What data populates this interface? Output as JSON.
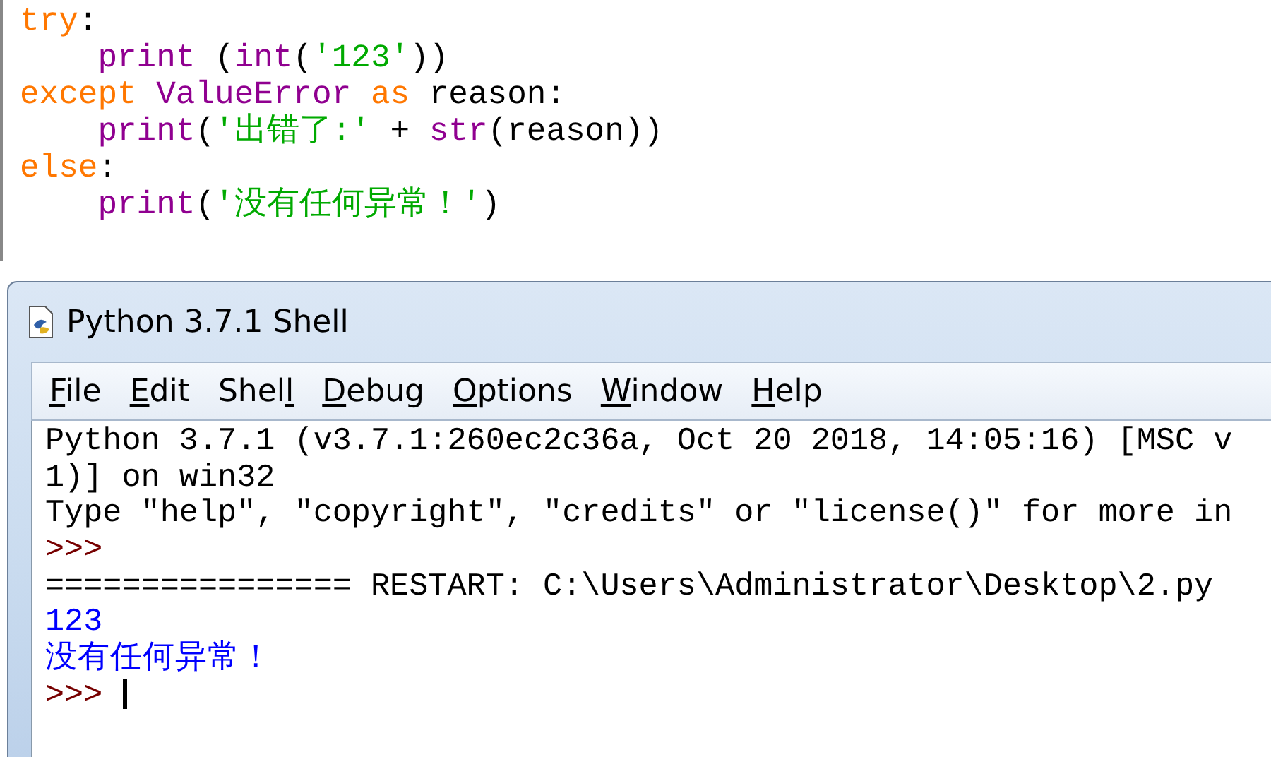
{
  "editor": {
    "lines": [
      {
        "indented": false,
        "tokens": [
          {
            "kind": "keyword",
            "text": "try"
          },
          {
            "kind": "plain",
            "text": ":"
          }
        ]
      },
      {
        "indented": true,
        "tokens": [
          {
            "kind": "builtin",
            "text": "print"
          },
          {
            "kind": "plain",
            "text": "(",
            "space_before": true
          },
          {
            "kind": "builtin",
            "text": "int"
          },
          {
            "kind": "plain",
            "text": "("
          },
          {
            "kind": "string",
            "text": "'123'"
          },
          {
            "kind": "plain",
            "text": "))"
          }
        ]
      },
      {
        "indented": false,
        "tokens": [
          {
            "kind": "keyword",
            "text": "except"
          },
          {
            "kind": "builtin",
            "text": "ValueError",
            "space_before": true
          },
          {
            "kind": "keyword",
            "text": "as",
            "space_before": true
          },
          {
            "kind": "plain",
            "text": "reason:",
            "space_before": true
          }
        ]
      },
      {
        "indented": true,
        "tokens": [
          {
            "kind": "builtin",
            "text": "print"
          },
          {
            "kind": "plain",
            "text": "("
          },
          {
            "kind": "string",
            "text": "'出错了:'"
          },
          {
            "kind": "plain",
            "text": "+",
            "space_before": true
          },
          {
            "kind": "builtin",
            "text": "str",
            "space_before": true
          },
          {
            "kind": "plain",
            "text": "(reason))"
          }
        ]
      },
      {
        "indented": false,
        "tokens": [
          {
            "kind": "keyword",
            "text": "else"
          },
          {
            "kind": "plain",
            "text": ":"
          }
        ]
      },
      {
        "indented": true,
        "tokens": [
          {
            "kind": "builtin",
            "text": "print"
          },
          {
            "kind": "plain",
            "text": "("
          },
          {
            "kind": "string",
            "text": "'没有任何异常！'"
          },
          {
            "kind": "plain",
            "text": ")"
          }
        ]
      }
    ]
  },
  "window": {
    "title": "Python 3.7.1 Shell"
  },
  "menu": [
    {
      "key": "F",
      "rest": "ile"
    },
    {
      "key": "E",
      "rest": "dit"
    },
    {
      "lead": "Shel",
      "key": "l"
    },
    {
      "key": "D",
      "rest": "ebug"
    },
    {
      "key": "O",
      "rest": "ptions"
    },
    {
      "key": "W",
      "rest": "indow"
    },
    {
      "key": "H",
      "rest": "elp"
    }
  ],
  "shell": {
    "lines": [
      {
        "cursor": false,
        "tokens": [
          {
            "kind": "output",
            "text": "Python 3.7.1 (v3.7.1:260ec2c36a, Oct 20 2018, 14:05:16) [MSC v"
          }
        ]
      },
      {
        "cursor": false,
        "tokens": [
          {
            "kind": "output",
            "text": "1)] on win32"
          }
        ]
      },
      {
        "cursor": false,
        "tokens": [
          {
            "kind": "output",
            "text": "Type \"help\", \"copyright\", \"credits\" or \"license()\" for more in"
          }
        ]
      },
      {
        "cursor": false,
        "tokens": [
          {
            "kind": "prompt",
            "text": ">>>"
          }
        ]
      },
      {
        "cursor": false,
        "tokens": [
          {
            "kind": "output",
            "text": "================ RESTART: C:\\Users\\Administrator\\Desktop\\2.py"
          }
        ]
      },
      {
        "cursor": false,
        "tokens": [
          {
            "kind": "stdout",
            "text": "123"
          }
        ]
      },
      {
        "cursor": false,
        "tokens": [
          {
            "kind": "stdout",
            "text": "没有任何异常！"
          }
        ]
      },
      {
        "cursor": true,
        "tokens": [
          {
            "kind": "prompt",
            "text": ">>>"
          }
        ]
      }
    ]
  }
}
